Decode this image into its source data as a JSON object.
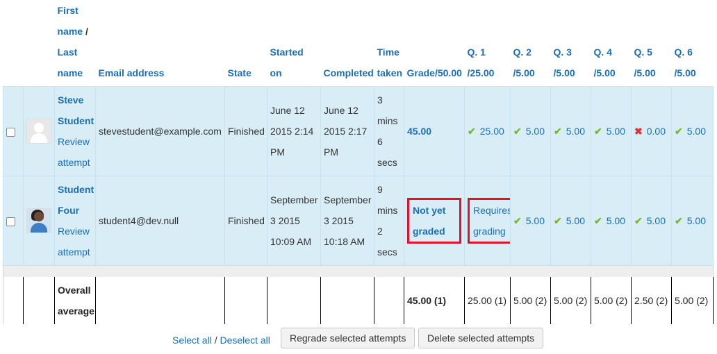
{
  "headers": {
    "first_name": "First name",
    "slash": " / ",
    "last_name": "Last name",
    "email": "Email address",
    "state": "State",
    "started": "Started on",
    "completed": "Completed",
    "time_taken": "Time taken",
    "grade": "Grade/50.00",
    "questions": [
      {
        "q": "Q. 1",
        "max": "/25.00"
      },
      {
        "q": "Q. 2",
        "max": "/5.00"
      },
      {
        "q": "Q. 3",
        "max": "/5.00"
      },
      {
        "q": "Q. 4",
        "max": "/5.00"
      },
      {
        "q": "Q. 5",
        "max": "/5.00"
      },
      {
        "q": "Q. 6",
        "max": "/5.00"
      }
    ]
  },
  "rows": [
    {
      "name": "Steve Student",
      "review": "Review attempt",
      "email": "stevestudent@example.com",
      "state": "Finished",
      "started": "June 12 2015 2:14 PM",
      "completed": "June 12 2015 2:17 PM",
      "time_taken": "3 mins 6 secs",
      "grade": "45.00",
      "marks": [
        {
          "value": "25.00",
          "icon": "check"
        },
        {
          "value": "5.00",
          "icon": "check"
        },
        {
          "value": "5.00",
          "icon": "check"
        },
        {
          "value": "5.00",
          "icon": "check"
        },
        {
          "value": "0.00",
          "icon": "cross"
        },
        {
          "value": "5.00",
          "icon": "check"
        }
      ]
    },
    {
      "name": "Student Four",
      "review": "Review attempt",
      "email": "student4@dev.null",
      "state": "Finished",
      "started": "September 3 2015 10:09 AM",
      "completed": "September 3 2015 10:18 AM",
      "time_taken": "9 mins 2 secs",
      "grade": "Not yet graded",
      "marks": [
        {
          "value": "Requires grading",
          "icon": "none"
        },
        {
          "value": "5.00",
          "icon": "check"
        },
        {
          "value": "5.00",
          "icon": "check"
        },
        {
          "value": "5.00",
          "icon": "check"
        },
        {
          "value": "5.00",
          "icon": "check"
        },
        {
          "value": "5.00",
          "icon": "check"
        }
      ]
    }
  ],
  "average": {
    "label": "Overall average",
    "grade": "45.00 (1)",
    "marks": [
      "25.00 (1)",
      "5.00 (2)",
      "5.00 (2)",
      "5.00 (2)",
      "2.50 (2)",
      "5.00 (2)"
    ]
  },
  "footer": {
    "select_all": "Select all",
    "separator": " / ",
    "deselect_all": "Deselect all",
    "regrade": "Regrade selected attempts",
    "delete": "Delete selected attempts"
  },
  "colors": {
    "link": "#1a6fb5",
    "row_bg": "#d9edf7",
    "highlight": "#e0112b",
    "check": "#79b829",
    "cross": "#dd3333"
  },
  "icons": {
    "correct": "check-icon",
    "incorrect": "cross-icon",
    "user": "user-avatar"
  }
}
